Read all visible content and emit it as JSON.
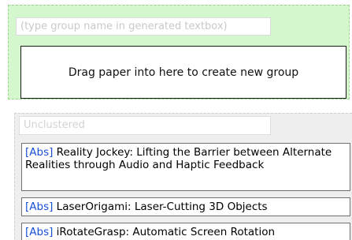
{
  "new_group": {
    "name_placeholder": "(type group name in generated textbox)",
    "drop_hint": "Drag paper into here to create new group"
  },
  "unclustered": {
    "label": "Unclustered",
    "papers": [
      {
        "abs_label": "[Abs]",
        "title": "Reality Jockey: Lifting the Barrier between Alternate Realities through Audio and Haptic Feedback"
      },
      {
        "abs_label": "[Abs]",
        "title": "LaserOrigami: Laser-Cutting 3D Objects"
      },
      {
        "abs_label": "[Abs]",
        "title": "iRotateGrasp: Automatic Screen Rotation"
      }
    ]
  },
  "colors": {
    "new_group_bg": "#d4f7cd",
    "unclustered_bg": "#eeeeee",
    "link": "#1a4fd6"
  }
}
